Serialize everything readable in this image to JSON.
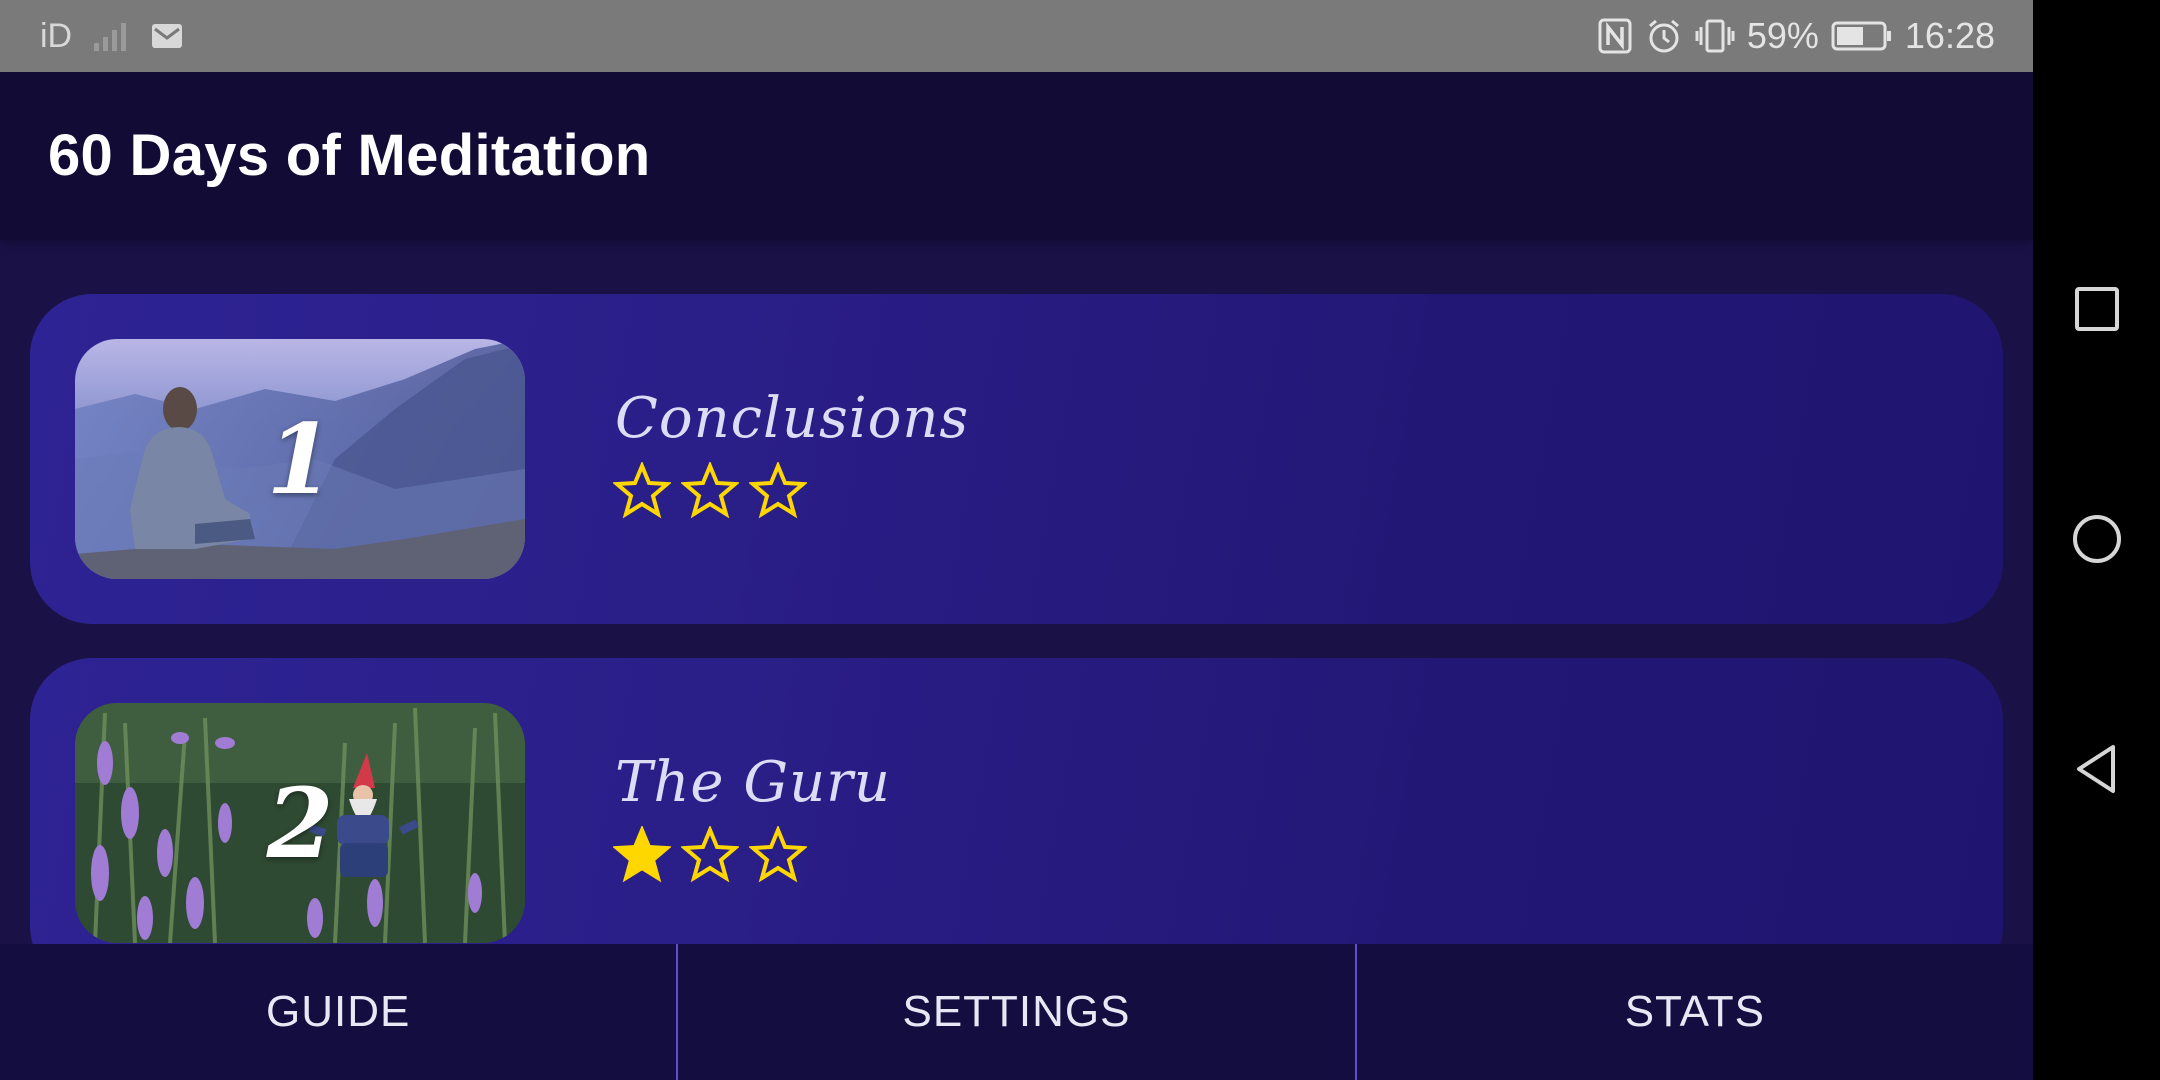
{
  "status_bar": {
    "carrier": "iD",
    "battery_percent": "59%",
    "time": "16:28",
    "icons": [
      "signal-icon",
      "mail-icon",
      "nfc-icon",
      "alarm-icon",
      "vibrate-icon",
      "battery-icon"
    ]
  },
  "app": {
    "title": "60 Days of Meditation"
  },
  "levels": [
    {
      "number": "1",
      "title": "Conclusions",
      "stars_earned": 0,
      "stars_total": 3,
      "image": "man-meditating-on-cliff"
    },
    {
      "number": "2",
      "title": "The Guru",
      "stars_earned": 1,
      "stars_total": 3,
      "image": "garden-gnome-among-lavender"
    }
  ],
  "bottom_nav": {
    "guide": "GUIDE",
    "settings": "SETTINGS",
    "stats": "STATS"
  },
  "system_nav": {
    "icons": [
      "recents-icon",
      "home-icon",
      "back-icon"
    ]
  },
  "colors": {
    "header": "#110b36",
    "background": "#1a1147",
    "card": "#2a1e88",
    "star": "#ffd700",
    "nav_divider": "#5d4fd0"
  }
}
